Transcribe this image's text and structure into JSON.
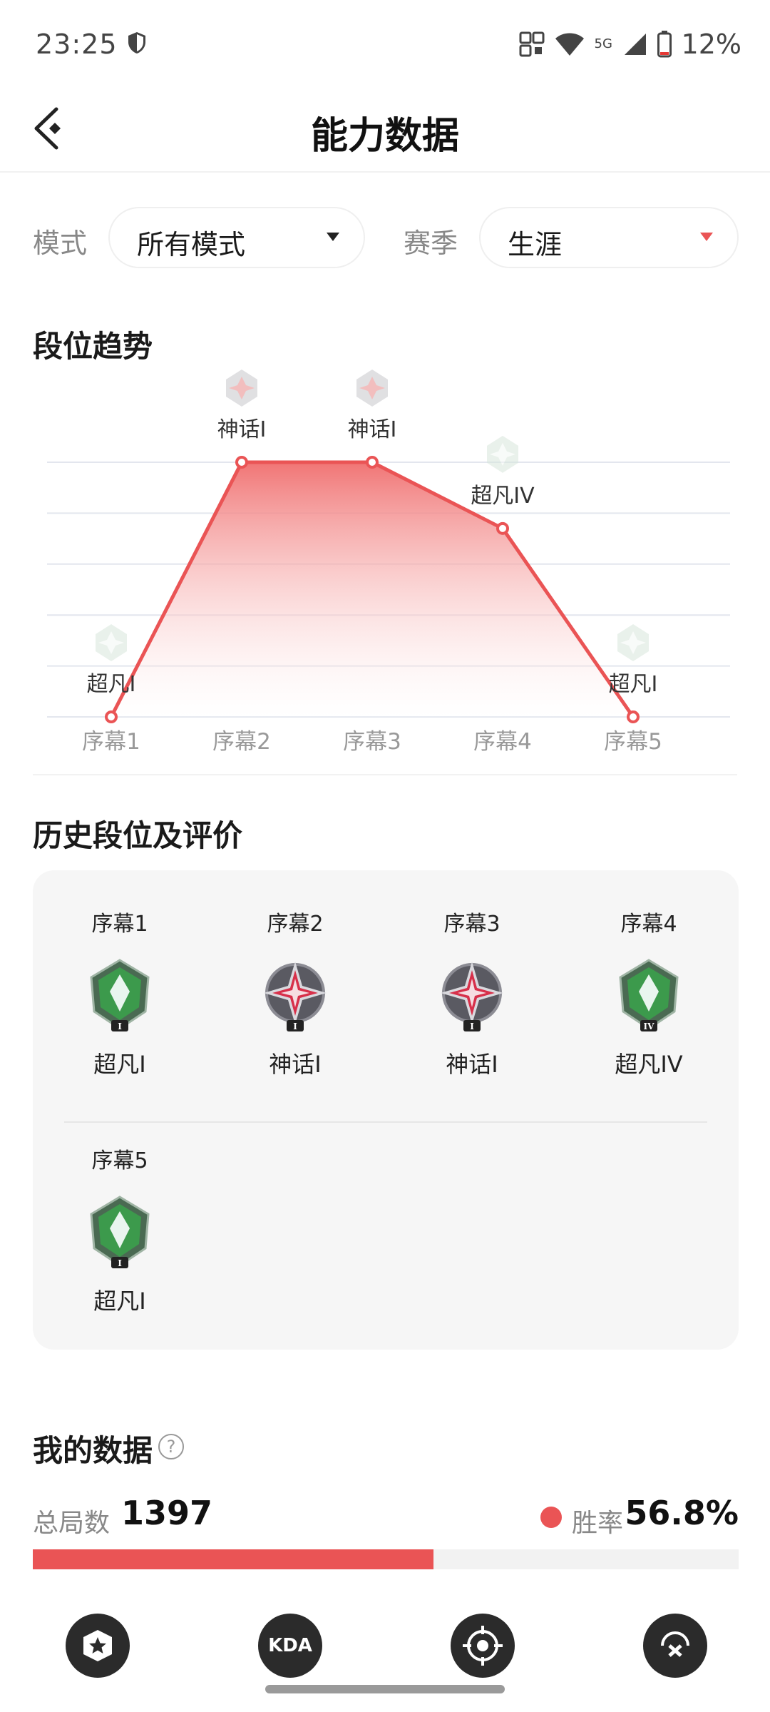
{
  "status_bar": {
    "time": "23:25",
    "battery": "12%",
    "network": "5G"
  },
  "header": {
    "title": "能力数据"
  },
  "filters": {
    "mode_label": "模式",
    "mode_value": "所有模式",
    "season_label": "赛季",
    "season_value": "生涯"
  },
  "trend": {
    "title": "段位趋势"
  },
  "chart_data": {
    "type": "area",
    "categories": [
      "序幕1",
      "序幕2",
      "序幕3",
      "序幕4",
      "序幕5"
    ],
    "values": [
      0,
      5,
      5,
      3.7,
      0
    ],
    "point_labels": [
      "超凡I",
      "神话I",
      "神话I",
      "超凡IV",
      "超凡I"
    ],
    "ylim": [
      0,
      5
    ],
    "grid": true,
    "line_color": "#ea5455",
    "fill_color": "#f28b8b"
  },
  "history": {
    "title": "历史段位及评价",
    "items": [
      {
        "label": "序幕1",
        "rank": "超凡I",
        "tier": "超凡"
      },
      {
        "label": "序幕2",
        "rank": "神话I",
        "tier": "神话"
      },
      {
        "label": "序幕3",
        "rank": "神话I",
        "tier": "神话"
      },
      {
        "label": "序幕4",
        "rank": "超凡IV",
        "tier": "超凡"
      },
      {
        "label": "序幕5",
        "rank": "超凡I",
        "tier": "超凡"
      }
    ]
  },
  "my_data": {
    "title": "我的数据",
    "help": "?",
    "total_label": "总局数",
    "total_value": "1397",
    "win_label": "胜率",
    "win_value": "56.8%",
    "win_fraction": 0.568
  },
  "tabs": [
    {
      "name": "star-tab-icon",
      "text": ""
    },
    {
      "name": "kda-tab-icon",
      "text": "KDA"
    },
    {
      "name": "target-tab-icon",
      "text": ""
    },
    {
      "name": "crosshair-tab-icon",
      "text": ""
    }
  ],
  "colors": {
    "accent": "#ea5455"
  }
}
